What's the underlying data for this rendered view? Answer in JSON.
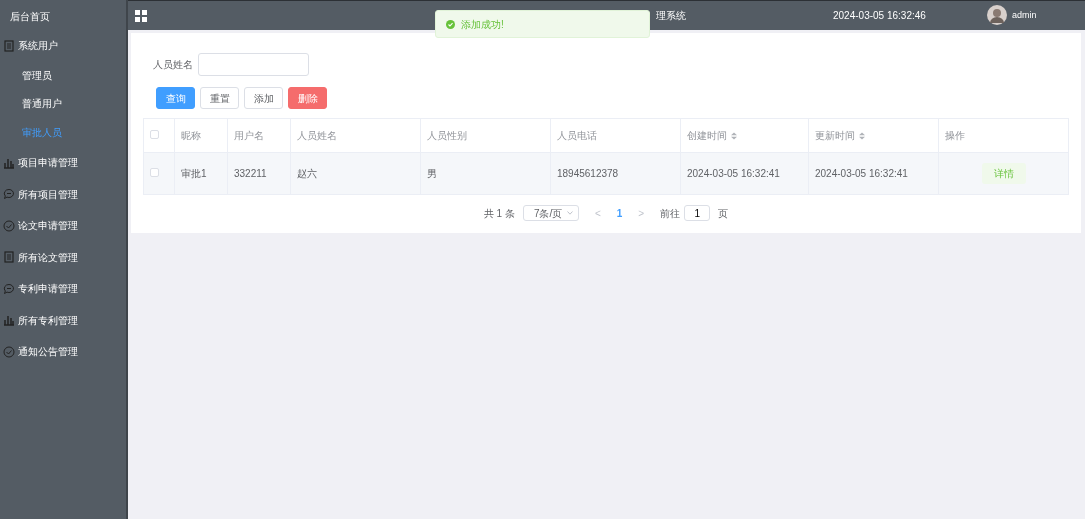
{
  "sidebar": {
    "home": "后台首页",
    "items": [
      {
        "label": "系统用户",
        "kind": "doc",
        "expanded": true,
        "children": [
          {
            "label": "管理员",
            "selected": false
          },
          {
            "label": "普通用户",
            "selected": false
          },
          {
            "label": "审批人员",
            "selected": true
          }
        ]
      },
      {
        "label": "项目申请管理",
        "kind": "bars",
        "expanded": false
      },
      {
        "label": "所有项目管理",
        "kind": "chat",
        "expanded": false
      },
      {
        "label": "论文申请管理",
        "kind": "check",
        "expanded": false
      },
      {
        "label": "所有论文管理",
        "kind": "doc",
        "expanded": false
      },
      {
        "label": "专利申请管理",
        "kind": "chat",
        "expanded": false
      },
      {
        "label": "所有专利管理",
        "kind": "bars",
        "expanded": false
      },
      {
        "label": "通知公告管理",
        "kind": "check",
        "expanded": false
      }
    ]
  },
  "header": {
    "title": "理系统",
    "datetime": "2024-03-05 16:32:46",
    "user": "admin"
  },
  "toast": {
    "message": "添加成功!",
    "kind": "success"
  },
  "search": {
    "label": "人员姓名"
  },
  "buttons": [
    {
      "label": "查询",
      "kind": "primary"
    },
    {
      "label": "重置",
      "kind": "default"
    },
    {
      "label": "添加",
      "kind": "default"
    },
    {
      "label": "删除",
      "kind": "danger"
    }
  ],
  "table": {
    "columns": [
      {
        "label": "昵称",
        "sortable": false
      },
      {
        "label": "用户名",
        "sortable": false
      },
      {
        "label": "人员姓名",
        "sortable": false
      },
      {
        "label": "人员性别",
        "sortable": false
      },
      {
        "label": "人员电话",
        "sortable": false
      },
      {
        "label": "创建时间",
        "sortable": true
      },
      {
        "label": "更新时间",
        "sortable": true
      },
      {
        "label": "操作",
        "sortable": false
      }
    ],
    "all_checked": false,
    "rows": [
      {
        "checked": false,
        "cells": [
          "审批1",
          "332211",
          "赵六",
          "男",
          "18945612378",
          "2024-03-05 16:32:41",
          "2024-03-05 16:32:41"
        ],
        "action": "详情"
      }
    ]
  },
  "pagination": {
    "total": "共 1 条",
    "page_size": "7条/页",
    "prev": "<",
    "pages": [
      {
        "label": "1",
        "selected": true
      }
    ],
    "next": ">",
    "goto_label": "前往",
    "goto_value": "1",
    "goto_suffix": "页"
  }
}
